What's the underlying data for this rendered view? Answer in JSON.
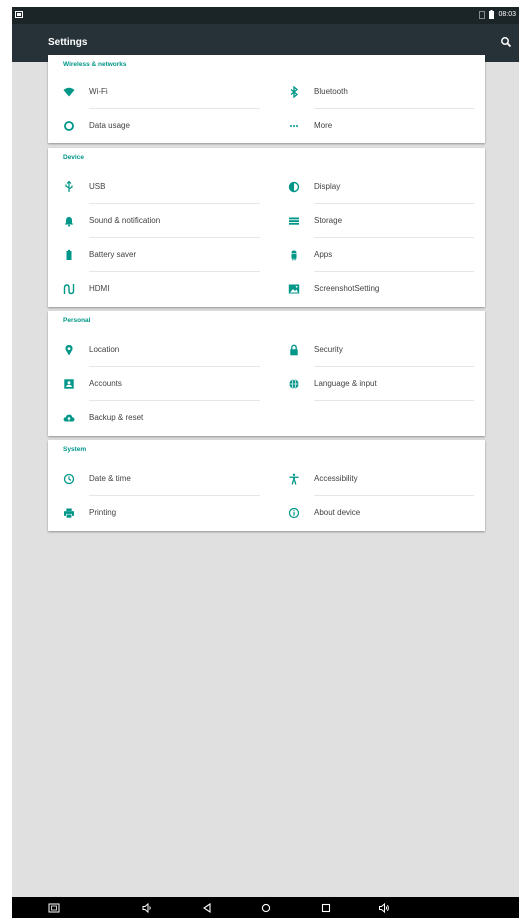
{
  "status_bar": {
    "time": "08:03"
  },
  "app_bar": {
    "title": "Settings"
  },
  "sections": {
    "wireless": {
      "title": "Wireless & networks",
      "items": [
        {
          "label": "Wi-Fi",
          "icon": "wifi-icon"
        },
        {
          "label": "Bluetooth",
          "icon": "bluetooth-icon"
        },
        {
          "label": "Data usage",
          "icon": "data-usage-icon"
        },
        {
          "label": "More",
          "icon": "more-icon"
        }
      ]
    },
    "device": {
      "title": "Device",
      "items": [
        {
          "label": "USB",
          "icon": "usb-icon"
        },
        {
          "label": "Display",
          "icon": "display-icon"
        },
        {
          "label": "Sound & notification",
          "icon": "bell-icon"
        },
        {
          "label": "Storage",
          "icon": "storage-icon"
        },
        {
          "label": "Battery saver",
          "icon": "battery-icon"
        },
        {
          "label": "Apps",
          "icon": "android-icon"
        },
        {
          "label": "HDMI",
          "icon": "hdmi-icon"
        },
        {
          "label": "ScreenshotSetting",
          "icon": "screenshot-icon"
        }
      ]
    },
    "personal": {
      "title": "Personal",
      "items": [
        {
          "label": "Location",
          "icon": "location-pin-icon"
        },
        {
          "label": "Security",
          "icon": "lock-icon"
        },
        {
          "label": "Accounts",
          "icon": "account-box-icon"
        },
        {
          "label": "Language & input",
          "icon": "globe-icon"
        },
        {
          "label": "Backup & reset",
          "icon": "cloud-upload-icon"
        }
      ]
    },
    "system": {
      "title": "System",
      "items": [
        {
          "label": "Date & time",
          "icon": "clock-icon"
        },
        {
          "label": "Accessibility",
          "icon": "accessibility-icon"
        },
        {
          "label": "Printing",
          "icon": "printer-icon"
        },
        {
          "label": "About device",
          "icon": "info-icon"
        }
      ]
    }
  },
  "colors": {
    "accent": "#009688",
    "app_bar": "#273238",
    "status_bar": "#1b2427",
    "background": "#e0e0e0"
  }
}
